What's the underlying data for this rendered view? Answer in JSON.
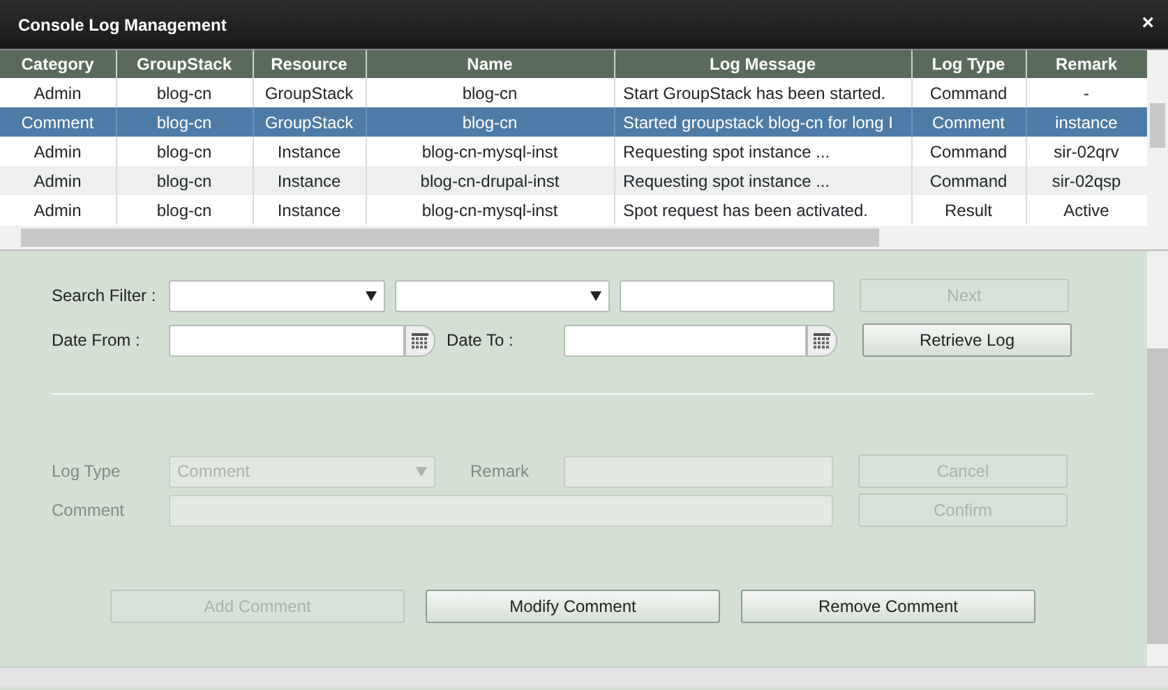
{
  "window": {
    "title": "Console Log Management",
    "close": "×"
  },
  "table": {
    "columns": [
      "Category",
      "GroupStack",
      "Resource",
      "Name",
      "Log Message",
      "Log Type",
      "Remark"
    ],
    "rows": [
      {
        "selected": false,
        "cells": [
          "Admin",
          "blog-cn",
          "GroupStack",
          "blog-cn",
          "Start GroupStack has been started.",
          "Command",
          "-"
        ]
      },
      {
        "selected": true,
        "cells": [
          "Comment",
          "blog-cn",
          "GroupStack",
          "blog-cn",
          "Started groupstack blog-cn for long I",
          "Comment",
          "instance"
        ]
      },
      {
        "selected": false,
        "cells": [
          "Admin",
          "blog-cn",
          "Instance",
          "blog-cn-mysql-inst",
          "Requesting spot instance ...",
          "Command",
          "sir-02qrv"
        ]
      },
      {
        "selected": false,
        "cells": [
          "Admin",
          "blog-cn",
          "Instance",
          "blog-cn-drupal-inst",
          "Requesting spot instance ...",
          "Command",
          "sir-02qsp"
        ]
      },
      {
        "selected": false,
        "cells": [
          "Admin",
          "blog-cn",
          "Instance",
          "blog-cn-mysql-inst",
          "Spot request has been activated.",
          "Result",
          "Active"
        ]
      }
    ]
  },
  "search": {
    "filter_label": "Search Filter :",
    "date_from_label": "Date From :",
    "date_to_label": "Date To :",
    "next": {
      "label": "Next",
      "disabled": true
    },
    "retrieve": {
      "label": "Retrieve Log",
      "disabled": false
    }
  },
  "comment_form": {
    "disabled": true,
    "log_type_label": "Log Type",
    "log_type_value": "Comment",
    "remark_label": "Remark",
    "comment_label": "Comment",
    "cancel": {
      "label": "Cancel",
      "disabled": true
    },
    "confirm": {
      "label": "Confirm",
      "disabled": true
    }
  },
  "buttons": [
    {
      "label": "Add Comment",
      "disabled": true
    },
    {
      "label": "Modify Comment",
      "disabled": false
    },
    {
      "label": "Remove Comment",
      "disabled": false
    }
  ]
}
